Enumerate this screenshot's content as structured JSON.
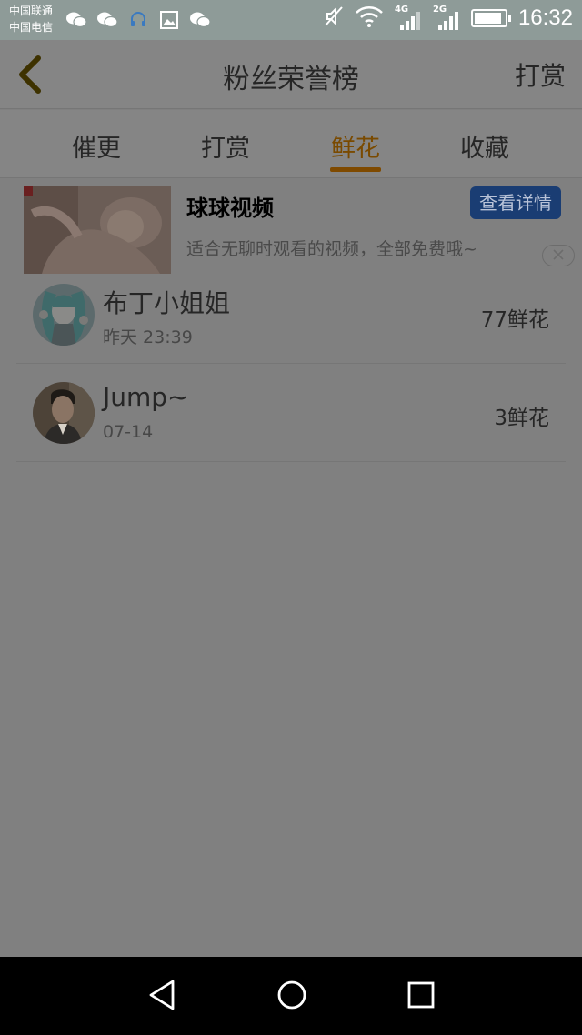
{
  "status_bar": {
    "carrier_1": "中国联通",
    "carrier_2": "中国电信",
    "network_1": "4G",
    "network_2": "2G",
    "time": "16:32",
    "battery_level": 0.9,
    "icons": [
      "wechat-icon",
      "wechat-icon",
      "headset-icon",
      "image-icon",
      "wechat-icon",
      "mute-icon",
      "wifi-icon",
      "signal-icon",
      "signal-icon",
      "battery-icon"
    ]
  },
  "header": {
    "back_icon": "chevron-left-icon",
    "title": "粉丝荣誉榜",
    "action_label": "打赏"
  },
  "tabs": [
    {
      "label": "催更",
      "active": false
    },
    {
      "label": "打赏",
      "active": false
    },
    {
      "label": "鲜花",
      "active": true
    },
    {
      "label": "收藏",
      "active": false
    }
  ],
  "ad": {
    "title": "球球视频",
    "button_label": "查看详情",
    "description": "适合无聊时观看的视频，全部免费哦~",
    "close_icon": "close-icon"
  },
  "fans": [
    {
      "name": "布丁小姐姐",
      "time": "昨天 23:39",
      "count": "77鲜花"
    },
    {
      "name": "Jump~",
      "time": "07-14",
      "count": "3鲜花"
    }
  ],
  "nav": {
    "icons": [
      "back-triangle-icon",
      "home-circle-icon",
      "recents-square-icon"
    ]
  },
  "colors": {
    "accent": "#7f4a00",
    "ad_button": "#1a3d73",
    "overlay_gray": "#808080"
  }
}
